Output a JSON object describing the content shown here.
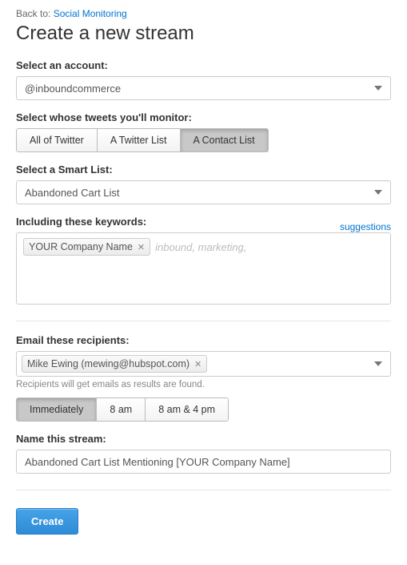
{
  "back": {
    "prefix": "Back to: ",
    "link_text": "Social Monitoring"
  },
  "title": "Create a new stream",
  "account": {
    "label": "Select an account:",
    "value": "@inboundcommerce"
  },
  "monitor": {
    "label": "Select whose tweets you'll monitor:",
    "options": [
      "All of Twitter",
      "A Twitter List",
      "A Contact List"
    ],
    "active_index": 2
  },
  "smartlist": {
    "label": "Select a Smart List:",
    "value": "Abandoned Cart List"
  },
  "keywords": {
    "label": "Including these keywords:",
    "suggestions_link": "suggestions",
    "tags": [
      "YOUR Company Name"
    ],
    "placeholder": "inbound, marketing,"
  },
  "recipients": {
    "label": "Email these recipients:",
    "tags": [
      "Mike Ewing (mewing@hubspot.com)"
    ],
    "helper": "Recipients will get emails as results are found."
  },
  "frequency": {
    "options": [
      "Immediately",
      "8 am",
      "8 am & 4 pm"
    ],
    "active_index": 0
  },
  "name": {
    "label": "Name this stream:",
    "value": "Abandoned Cart List Mentioning [YOUR Company Name]"
  },
  "create_label": "Create"
}
